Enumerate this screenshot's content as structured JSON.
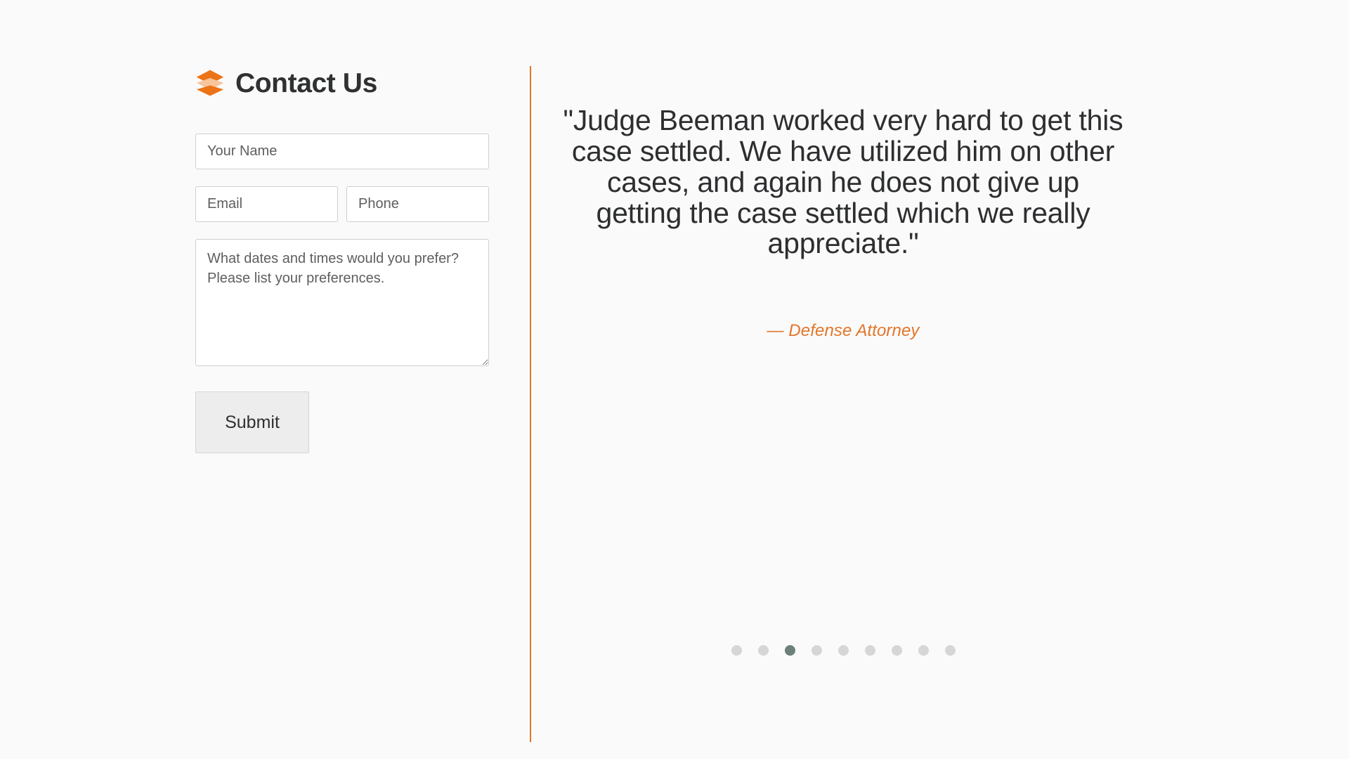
{
  "theme": {
    "background": "#fafafa",
    "accent": "#e2762a",
    "accent_light": "#f6c197",
    "heading_color": "#2f3032",
    "dot_inactive": "#d6d6d6",
    "dot_active": "#6d8079"
  },
  "brand": {
    "icon": "layers-icon",
    "title": "Contact Us"
  },
  "form": {
    "fields": [
      {
        "name": "your-name",
        "placeholder": "Your Name",
        "value": "",
        "type": "text"
      },
      {
        "name": "email",
        "placeholder": "Email",
        "value": "",
        "type": "text"
      },
      {
        "name": "phone",
        "placeholder": "Phone",
        "value": "",
        "type": "text"
      }
    ],
    "message": {
      "name": "message",
      "placeholder": "What dates and times would you prefer?  Please list your preferences.",
      "value": ""
    },
    "submit_label": "Submit"
  },
  "testimonial": {
    "quote": "\"Judge Beeman worked very hard to get this case settled. We have utilized him on other cases, and again he does not give up getting the case settled which we really appreciate.\"",
    "attribution": "— Defense Attorney"
  },
  "carousel": {
    "total": 9,
    "active_index": 2,
    "dots": [
      {
        "label": "1"
      },
      {
        "label": "2"
      },
      {
        "label": "3"
      },
      {
        "label": "4"
      },
      {
        "label": "5"
      },
      {
        "label": "6"
      },
      {
        "label": "7"
      },
      {
        "label": "8"
      },
      {
        "label": "9"
      }
    ]
  }
}
